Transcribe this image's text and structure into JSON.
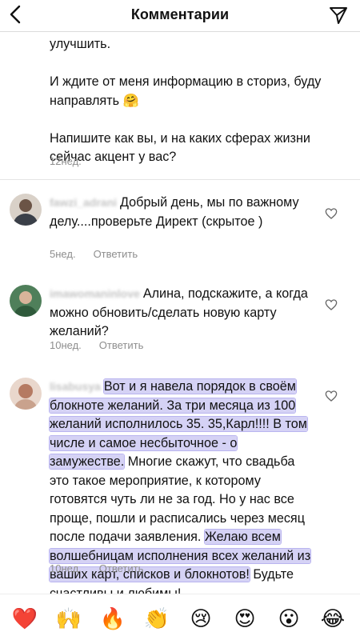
{
  "header": {
    "title": "Комментарии"
  },
  "top_comment": {
    "paragraphs": [
      "улучшить.",
      "И ждите от меня информацию в сториз, буду направлять 🤗",
      "Напишите как вы, и на каких сферах жизни сейчас акцент у вас?"
    ],
    "time": "12нед."
  },
  "comments": [
    {
      "username": "fawzi_adrani",
      "text": "Добрый день, мы по важному делу....проверьте Директ (скрытое )",
      "time": "5нед.",
      "reply_label": "Ответить"
    },
    {
      "username": "imawomaninlove",
      "text": "Алина, подскажите, а когда можно обновить/сделать новую карту желаний?",
      "time": "10нед.",
      "reply_label": "Ответить"
    },
    {
      "username": "lisabusya",
      "segments": [
        {
          "text": "Вот и я навела порядок в своём блокноте желаний. За три месяца из 100 желаний исполнилось 35. 35,Карл!!!! В том числе и самое несбыточное - о замужестве.",
          "highlight": true
        },
        {
          "text": " Многие скажут, что свадьба это такое мероприятие, к которому готовятся чуть ли не за год. Но у нас все проще, пошли и расписались через месяц после подачи заявления. ",
          "highlight": false
        },
        {
          "text": "Желаю всем волшебницам исполнения всех желаний из ваших карт, списков и блокнотов!",
          "highlight": true
        },
        {
          "text": " Будьте счастливы и любимы!",
          "highlight": false
        }
      ],
      "time": "10нед.",
      "reply_label": "Ответить"
    }
  ],
  "emoji_bar": [
    {
      "icon": "red-heart",
      "glyph": "❤️"
    },
    {
      "icon": "raising-hands",
      "glyph": "🙌"
    },
    {
      "icon": "fire",
      "glyph": "🔥"
    },
    {
      "icon": "clapping-hands",
      "glyph": "👏"
    },
    {
      "icon": "crying-face",
      "glyph": "😢"
    },
    {
      "icon": "heart-eyes",
      "glyph": "😍"
    },
    {
      "icon": "astonished-face",
      "glyph": "😮"
    },
    {
      "icon": "tears-of-joy",
      "glyph": "😂"
    }
  ],
  "colors": {
    "highlight": "#d5d2f5",
    "meta_text": "#8e8e8e"
  }
}
